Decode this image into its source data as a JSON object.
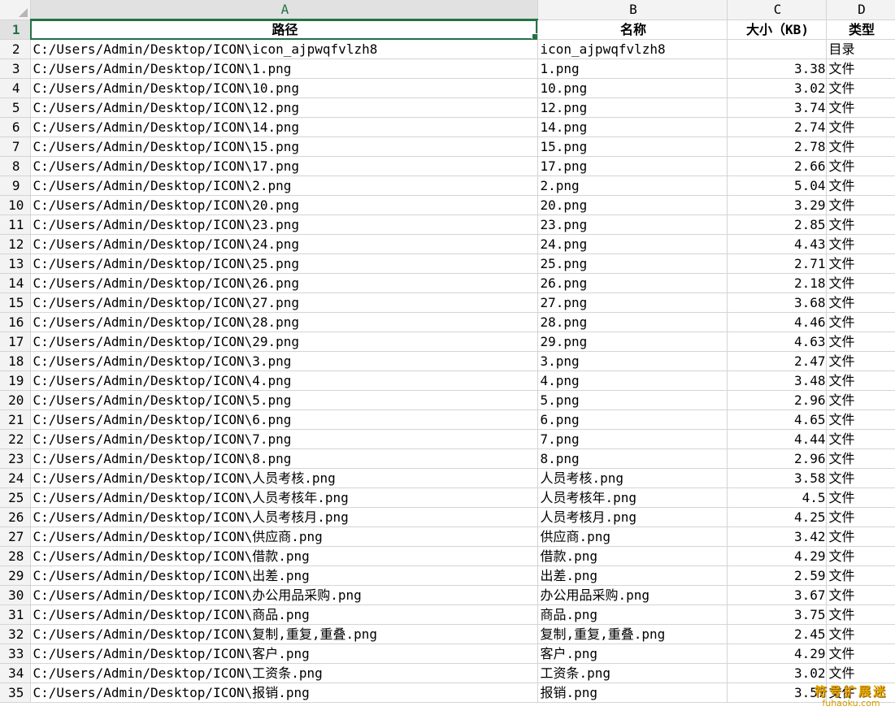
{
  "columns": [
    "A",
    "B",
    "C",
    "D"
  ],
  "header_row": {
    "row_number": "1",
    "path": "路径",
    "name": "名称",
    "size": "大小（KB)",
    "type": "类型"
  },
  "rows": [
    {
      "n": "2",
      "path": "C:/Users/Admin/Desktop/ICON\\icon_ajpwqfvlzh8",
      "name": "icon_ajpwqfvlzh8",
      "size": "",
      "type": "目录"
    },
    {
      "n": "3",
      "path": "C:/Users/Admin/Desktop/ICON\\1.png",
      "name": "1.png",
      "size": "3.38",
      "type": "文件"
    },
    {
      "n": "4",
      "path": "C:/Users/Admin/Desktop/ICON\\10.png",
      "name": "10.png",
      "size": "3.02",
      "type": "文件"
    },
    {
      "n": "5",
      "path": "C:/Users/Admin/Desktop/ICON\\12.png",
      "name": "12.png",
      "size": "3.74",
      "type": "文件"
    },
    {
      "n": "6",
      "path": "C:/Users/Admin/Desktop/ICON\\14.png",
      "name": "14.png",
      "size": "2.74",
      "type": "文件"
    },
    {
      "n": "7",
      "path": "C:/Users/Admin/Desktop/ICON\\15.png",
      "name": "15.png",
      "size": "2.78",
      "type": "文件"
    },
    {
      "n": "8",
      "path": "C:/Users/Admin/Desktop/ICON\\17.png",
      "name": "17.png",
      "size": "2.66",
      "type": "文件"
    },
    {
      "n": "9",
      "path": "C:/Users/Admin/Desktop/ICON\\2.png",
      "name": "2.png",
      "size": "5.04",
      "type": "文件"
    },
    {
      "n": "10",
      "path": "C:/Users/Admin/Desktop/ICON\\20.png",
      "name": "20.png",
      "size": "3.29",
      "type": "文件"
    },
    {
      "n": "11",
      "path": "C:/Users/Admin/Desktop/ICON\\23.png",
      "name": "23.png",
      "size": "2.85",
      "type": "文件"
    },
    {
      "n": "12",
      "path": "C:/Users/Admin/Desktop/ICON\\24.png",
      "name": "24.png",
      "size": "4.43",
      "type": "文件"
    },
    {
      "n": "13",
      "path": "C:/Users/Admin/Desktop/ICON\\25.png",
      "name": "25.png",
      "size": "2.71",
      "type": "文件"
    },
    {
      "n": "14",
      "path": "C:/Users/Admin/Desktop/ICON\\26.png",
      "name": "26.png",
      "size": "2.18",
      "type": "文件"
    },
    {
      "n": "15",
      "path": "C:/Users/Admin/Desktop/ICON\\27.png",
      "name": "27.png",
      "size": "3.68",
      "type": "文件"
    },
    {
      "n": "16",
      "path": "C:/Users/Admin/Desktop/ICON\\28.png",
      "name": "28.png",
      "size": "4.46",
      "type": "文件"
    },
    {
      "n": "17",
      "path": "C:/Users/Admin/Desktop/ICON\\29.png",
      "name": "29.png",
      "size": "4.63",
      "type": "文件"
    },
    {
      "n": "18",
      "path": "C:/Users/Admin/Desktop/ICON\\3.png",
      "name": "3.png",
      "size": "2.47",
      "type": "文件"
    },
    {
      "n": "19",
      "path": "C:/Users/Admin/Desktop/ICON\\4.png",
      "name": "4.png",
      "size": "3.48",
      "type": "文件"
    },
    {
      "n": "20",
      "path": "C:/Users/Admin/Desktop/ICON\\5.png",
      "name": "5.png",
      "size": "2.96",
      "type": "文件"
    },
    {
      "n": "21",
      "path": "C:/Users/Admin/Desktop/ICON\\6.png",
      "name": "6.png",
      "size": "4.65",
      "type": "文件"
    },
    {
      "n": "22",
      "path": "C:/Users/Admin/Desktop/ICON\\7.png",
      "name": "7.png",
      "size": "4.44",
      "type": "文件"
    },
    {
      "n": "23",
      "path": "C:/Users/Admin/Desktop/ICON\\8.png",
      "name": "8.png",
      "size": "2.96",
      "type": "文件"
    },
    {
      "n": "24",
      "path": "C:/Users/Admin/Desktop/ICON\\人员考核.png",
      "name": "人员考核.png",
      "size": "3.58",
      "type": "文件"
    },
    {
      "n": "25",
      "path": "C:/Users/Admin/Desktop/ICON\\人员考核年.png",
      "name": "人员考核年.png",
      "size": "4.5",
      "type": "文件"
    },
    {
      "n": "26",
      "path": "C:/Users/Admin/Desktop/ICON\\人员考核月.png",
      "name": "人员考核月.png",
      "size": "4.25",
      "type": "文件"
    },
    {
      "n": "27",
      "path": "C:/Users/Admin/Desktop/ICON\\供应商.png",
      "name": "供应商.png",
      "size": "3.42",
      "type": "文件"
    },
    {
      "n": "28",
      "path": "C:/Users/Admin/Desktop/ICON\\借款.png",
      "name": "借款.png",
      "size": "4.29",
      "type": "文件"
    },
    {
      "n": "29",
      "path": "C:/Users/Admin/Desktop/ICON\\出差.png",
      "name": "出差.png",
      "size": "2.59",
      "type": "文件"
    },
    {
      "n": "30",
      "path": "C:/Users/Admin/Desktop/ICON\\办公用品采购.png",
      "name": "办公用品采购.png",
      "size": "3.67",
      "type": "文件"
    },
    {
      "n": "31",
      "path": "C:/Users/Admin/Desktop/ICON\\商品.png",
      "name": "商品.png",
      "size": "3.75",
      "type": "文件"
    },
    {
      "n": "32",
      "path": "C:/Users/Admin/Desktop/ICON\\复制,重复,重叠.png",
      "name": "复制,重复,重叠.png",
      "size": "2.45",
      "type": "文件"
    },
    {
      "n": "33",
      "path": "C:/Users/Admin/Desktop/ICON\\客户.png",
      "name": "客户.png",
      "size": "4.29",
      "type": "文件"
    },
    {
      "n": "34",
      "path": "C:/Users/Admin/Desktop/ICON\\工资条.png",
      "name": "工资条.png",
      "size": "3.02",
      "type": "文件"
    },
    {
      "n": "35",
      "path": "C:/Users/Admin/Desktop/ICON\\报销.png",
      "name": "报销.png",
      "size": "3.57",
      "type": "文件"
    }
  ],
  "watermark": {
    "title": "符号扩展迷",
    "url": "fuhaoku.com"
  },
  "colors": {
    "accent": "#217346",
    "grid": "#d4d4d4",
    "header_bg": "#f3f3f3"
  }
}
